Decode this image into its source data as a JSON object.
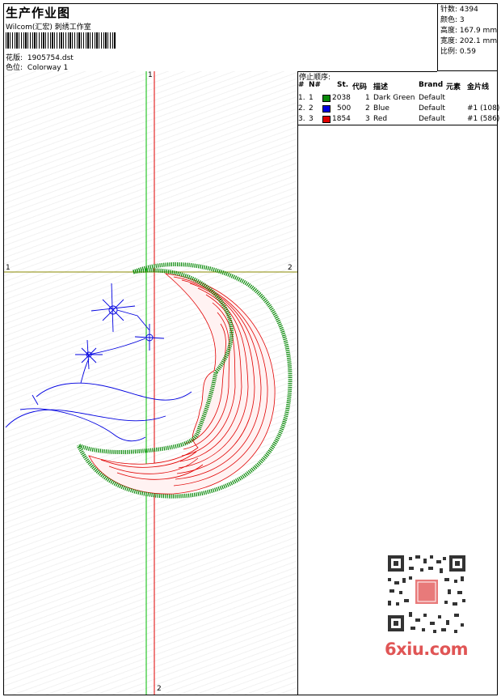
{
  "header": {
    "title": "生产作业图",
    "subtitle": "Wilcom(汇宏) 刺绣工作室",
    "design_label": "花版:",
    "design_value": "1905754.dst",
    "colorway_label": "色位:",
    "colorway_value": "Colorway 1"
  },
  "stats": [
    {
      "label": "针数:",
      "value": "4394"
    },
    {
      "label": "颜色:",
      "value": "3"
    },
    {
      "label": "高度:",
      "value": "167.9 mm"
    },
    {
      "label": "宽度:",
      "value": "202.1 mm"
    },
    {
      "label": "比例:",
      "value": "0.59"
    }
  ],
  "sequence": {
    "title": "停止顺序:",
    "headers": {
      "idx": "#",
      "no": "N#",
      "st": "St.",
      "code": "代码",
      "desc": "描述",
      "brand": "Brand",
      "element": "元素",
      "sequin": "金片线"
    },
    "rows": [
      {
        "idx": "1.",
        "no": "1",
        "color": "#0a8a0a",
        "st": "2038",
        "code": "1",
        "desc": "Dark Green",
        "brand": "Default",
        "sequin": ""
      },
      {
        "idx": "2.",
        "no": "2",
        "color": "#0000e0",
        "st": "500",
        "code": "2",
        "desc": "Blue",
        "brand": "Default",
        "sequin": "#1 (108)"
      },
      {
        "idx": "3.",
        "no": "3",
        "color": "#e00000",
        "st": "1854",
        "code": "3",
        "desc": "Red",
        "brand": "Default",
        "sequin": "#1 (586)"
      }
    ]
  },
  "canvas": {
    "markers": {
      "v_top": "1",
      "h_left": "1",
      "h_right": "2",
      "v_bottom": "2"
    }
  },
  "watermark": {
    "text": "6xiu.com"
  },
  "colors": {
    "green": "#0a8a0a",
    "blue": "#0000e0",
    "red": "#e00000",
    "olive": "#8a8a00"
  }
}
